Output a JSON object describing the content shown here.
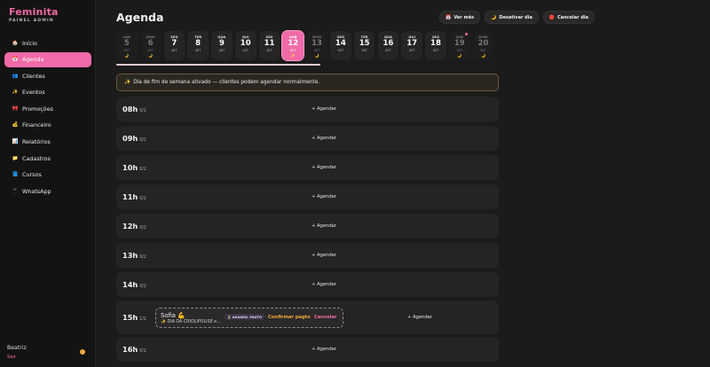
{
  "brand": {
    "title": "Feminita",
    "subtitle": "PAINEL ADMIN"
  },
  "nav": [
    {
      "label": "Início",
      "icon": "home-icon",
      "glyph": "🏠",
      "active": false
    },
    {
      "label": "Agenda",
      "icon": "calendar-icon",
      "glyph": "📅",
      "active": true
    },
    {
      "label": "Clientes",
      "icon": "users-icon",
      "glyph": "👥",
      "active": false
    },
    {
      "label": "Eventos",
      "icon": "sparkles-icon",
      "glyph": "✨",
      "active": false
    },
    {
      "label": "Promoções",
      "icon": "tag-icon",
      "glyph": "🎀",
      "active": false
    },
    {
      "label": "Financeiro",
      "icon": "money-bag-icon",
      "glyph": "💰",
      "active": false
    },
    {
      "label": "Relatórios",
      "icon": "chart-icon",
      "glyph": "📊",
      "active": false
    },
    {
      "label": "Cadastros",
      "icon": "folder-icon",
      "glyph": "📁",
      "active": false
    },
    {
      "label": "Cursos",
      "icon": "book-icon",
      "glyph": "📘",
      "active": false
    },
    {
      "label": "WhatsApp",
      "icon": "phone-icon",
      "glyph": "📱",
      "active": false
    }
  ],
  "user": {
    "name": "Beatriz",
    "logout": "Sair"
  },
  "header": {
    "title": "Agenda",
    "actions": [
      {
        "label": "Ver mês",
        "icon": "calendar-icon",
        "glyph": "📅"
      },
      {
        "label": "Desativar dia",
        "icon": "moon-icon",
        "glyph": "🌙"
      },
      {
        "label": "Cancelar dia",
        "icon": "cancel-icon",
        "glyph": "🔴"
      }
    ]
  },
  "days": [
    {
      "weekday": "SÁB",
      "num": "5",
      "month": "SET",
      "moon": "🌙",
      "dim": true,
      "selected": false,
      "dot": false
    },
    {
      "weekday": "DOM",
      "num": "6",
      "month": "SET",
      "moon": "🌙",
      "dim": true,
      "selected": false,
      "dot": false
    },
    {
      "weekday": "SEG",
      "num": "7",
      "month": "SET",
      "moon": "",
      "dim": false,
      "selected": false,
      "dot": false
    },
    {
      "weekday": "TER",
      "num": "8",
      "month": "SET",
      "moon": "",
      "dim": false,
      "selected": false,
      "dot": false
    },
    {
      "weekday": "QUA",
      "num": "9",
      "month": "SET",
      "moon": "",
      "dim": false,
      "selected": false,
      "dot": false
    },
    {
      "weekday": "QUI",
      "num": "10",
      "month": "SET",
      "moon": "",
      "dim": false,
      "selected": false,
      "dot": false
    },
    {
      "weekday": "SEX",
      "num": "11",
      "month": "SET",
      "moon": "",
      "dim": false,
      "selected": false,
      "dot": false
    },
    {
      "weekday": "SÁB",
      "num": "12",
      "month": "SET",
      "moon": "✨",
      "dim": false,
      "selected": true,
      "dot": false
    },
    {
      "weekday": "DOM",
      "num": "13",
      "month": "SET",
      "moon": "🌙",
      "dim": true,
      "selected": false,
      "dot": false
    },
    {
      "weekday": "SEG",
      "num": "14",
      "month": "SET",
      "moon": "",
      "dim": false,
      "selected": false,
      "dot": false
    },
    {
      "weekday": "TER",
      "num": "15",
      "month": "SET",
      "moon": "",
      "dim": false,
      "selected": false,
      "dot": false
    },
    {
      "weekday": "QUA",
      "num": "16",
      "month": "SET",
      "moon": "",
      "dim": false,
      "selected": false,
      "dot": false
    },
    {
      "weekday": "QUI",
      "num": "17",
      "month": "SET",
      "moon": "",
      "dim": false,
      "selected": false,
      "dot": false
    },
    {
      "weekday": "SEX",
      "num": "18",
      "month": "SET",
      "moon": "",
      "dim": false,
      "selected": false,
      "dot": false
    },
    {
      "weekday": "SÁB",
      "num": "19",
      "month": "SET",
      "moon": "🌙",
      "dim": true,
      "selected": false,
      "dot": true
    },
    {
      "weekday": "DOM",
      "num": "20",
      "month": "SET",
      "moon": "🌙",
      "dim": true,
      "selected": false,
      "dot": false
    }
  ],
  "notice": {
    "icon": "sparkles-icon",
    "glyph": "✨",
    "text": "Dia de fim de semana ativado — clientes podem agendar normalmente."
  },
  "slots": [
    {
      "hour": "08h",
      "count": "0/2",
      "add_label": "+ Agendar"
    },
    {
      "hour": "09h",
      "count": "0/2",
      "add_label": "+ Agendar"
    },
    {
      "hour": "10h",
      "count": "0/2",
      "add_label": "+ Agendar"
    },
    {
      "hour": "11h",
      "count": "0/2",
      "add_label": "+ Agendar"
    },
    {
      "hour": "12h",
      "count": "0/2",
      "add_label": "+ Agendar"
    },
    {
      "hour": "13h",
      "count": "0/2",
      "add_label": "+ Agendar"
    },
    {
      "hour": "14h",
      "count": "0/2",
      "add_label": "+ Agendar"
    },
    {
      "hour": "15h",
      "count": "1/2",
      "add_label": "+ Agendar",
      "appointment": {
        "client": "Sofia 💪",
        "service": "✨ DIA DA CRIOLIPOLISE  e...",
        "status": "⏳ AGUARD. PAGTO",
        "confirm_label": "Confirmar pagto",
        "cancel_label": "Cancelar"
      }
    },
    {
      "hour": "16h",
      "count": "0/2",
      "add_label": "+ Agendar"
    }
  ],
  "colors": {
    "accent": "#f06aa7",
    "warning": "#f0a93a",
    "background": "#1c1b1b",
    "sidebar": "#141313"
  }
}
